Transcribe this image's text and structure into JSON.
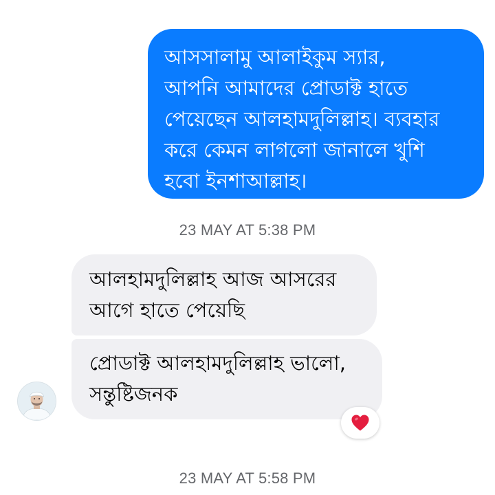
{
  "thread": {
    "outgoing_message": "আসসালামু আলাইকুম স্যার,\nআপনি আমাদের প্রোডাক্ট হাতে\nপেয়েছেন আলহামদুলিল্লাহ। ব্যবহার\nকরে কেমন লাগলো জানালে খুশি\nহবো ইনশাআল্লাহ।",
    "timestamp_1": "23 MAY AT 5:38 PM",
    "incoming_messages": [
      {
        "text": "আলহামদুলিল্লাহ আজ আসরের\nআগে হাতে পেয়েছি"
      },
      {
        "text": "প্রোডাক্ট আলহামদুলিল্লাহ ভালো,\nসন্তুষ্টিজনক"
      }
    ],
    "reaction": {
      "icon": "heart-icon",
      "color": "#e41e3f"
    },
    "timestamp_2": "23 MAY AT 5:58 PM"
  },
  "colors": {
    "outgoing_bubble": "#0a7cff",
    "incoming_bubble": "#f0f0f3",
    "timestamp_text": "#65676b"
  }
}
